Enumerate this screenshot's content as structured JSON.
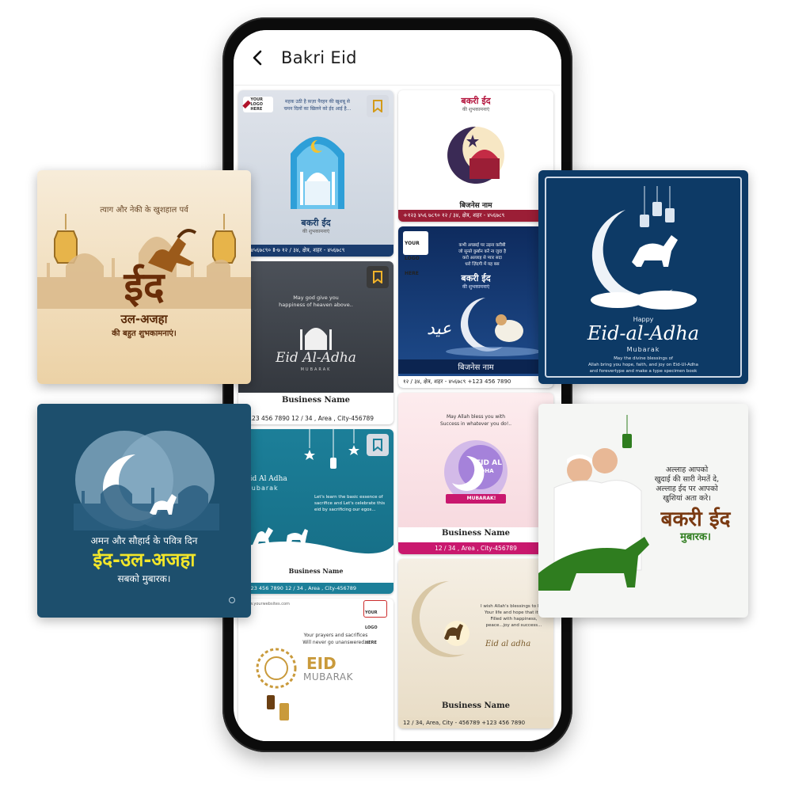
{
  "app": {
    "title": "Bakri Eid"
  },
  "grid_cards": [
    {
      "lines": [
        "महक उठी है फ़ज़ा पैरहन की खुशबू से",
        "चमन दिलों का खिलने को ईद आई है..."
      ],
      "logo": "YOUR LOGO HERE",
      "title": "बकरी ईद",
      "subtitle": "की शुभकामनाएं",
      "footer": "२३ ४५६७८९०   Ⅱ-७   १२ / ३४, क्षेत्र, शहर - ४५६७८९"
    },
    {
      "title": "बकरी ईद",
      "subtitle": "की शुभकामनाएं",
      "business": "बिजनेस नाम",
      "footer": "+१२३ ४५६ ७८९०   १२ / ३४, क्षेत्र, शहर - ४५६७८९"
    },
    {
      "wish_line1": "May god give you",
      "wish_line2": "happiness of heaven above..",
      "script": "Eid Al-Adha",
      "mubarak": "MUBARAK",
      "business": "Business Name",
      "footer": "+123 456 7890   12 / 34 , Area , City-456789"
    },
    {
      "logo": "YOUR LOGO HERE",
      "lines": [
        "कभी अच्छाई पर उड़ना करीबी",
        "जो सुनते कुर्बान करें ना जुदा है",
        "करो अल्लाह से प्यार सदा",
        "धरो ज़िंदगी में यह बस"
      ],
      "title": "बकरी ईद",
      "subtitle": "की शुभकामनाएं",
      "business": "बिजनेस नाम",
      "footer": "१२ / ३४, क्षेत्र, शहर - ४५६७८९   +123 456 7890"
    },
    {
      "title_line1": "Eid Al Adha",
      "title_line2": "mubarak",
      "lines": [
        "Let's learn the basic essence of",
        "sacrifice and Let's celebrate this",
        "eid by sacrificing our egos..."
      ],
      "business": "Business Name",
      "footer": "+123 456 7890   12 / 34 , Area , City-456789"
    },
    {
      "lines": [
        "May Allah bless you with",
        "Success in whatever you do!.."
      ],
      "eid": "EID AL",
      "adha": "ADHA",
      "ribbon": "MUBARAK!",
      "business": "Business Name",
      "footer": "12 / 34 , Area , City-456789"
    },
    {
      "website": "www.yourwebsites.com",
      "logo": "YOUR LOGO HERE",
      "lines": [
        "Your prayers and sacrifices",
        "Will never go unanswered..."
      ],
      "eid": "EID",
      "mubarak": "MUBARAK"
    },
    {
      "lines": [
        "I wish Allah's blessings to light",
        "Your life and hope that it is",
        "Filled with happiness,",
        "peace...joy and success..."
      ],
      "script": "Eid al adha",
      "business": "Business Name",
      "footer": "12 / 34, Area, City - 456789   +123 456 7890"
    }
  ],
  "floating_cards": {
    "left_top": {
      "line": "त्याग और नेकी के खुशहाल पर्व",
      "big": "ईद",
      "sub": "उल-अजहा",
      "wish": "की बहुत शुभकामनाएं।"
    },
    "left_bottom": {
      "line": "अमन और सौहार्द के पवित्र दिन",
      "big": "ईद-उल-अजहा",
      "wish": "सबको मुबारक।"
    },
    "right_top": {
      "happy": "Happy",
      "script": "Eid-al-Adha",
      "mubarak": "Mubarak",
      "lines": [
        "May the divine blessings of",
        "Allah bring you hope, faith, and joy on Eid-Ul-Adha",
        "and forevertype and make a type specimen book"
      ]
    },
    "right_bottom": {
      "lines": [
        "अल्लाह आपको",
        "खुदाई की सारी नेमतें दे,",
        "अल्लाह ईद पर आपको",
        "खुशियां अता करे।"
      ],
      "big": "बकरी ईद",
      "wish": "मुबारक।"
    }
  },
  "colors": {
    "phone": "#0c0c0c",
    "navy": "#0d3a66",
    "teal_card": "#1d4f6d",
    "gold": "#c99a3b",
    "green": "#2f7d1f",
    "brown": "#7a3a12"
  }
}
